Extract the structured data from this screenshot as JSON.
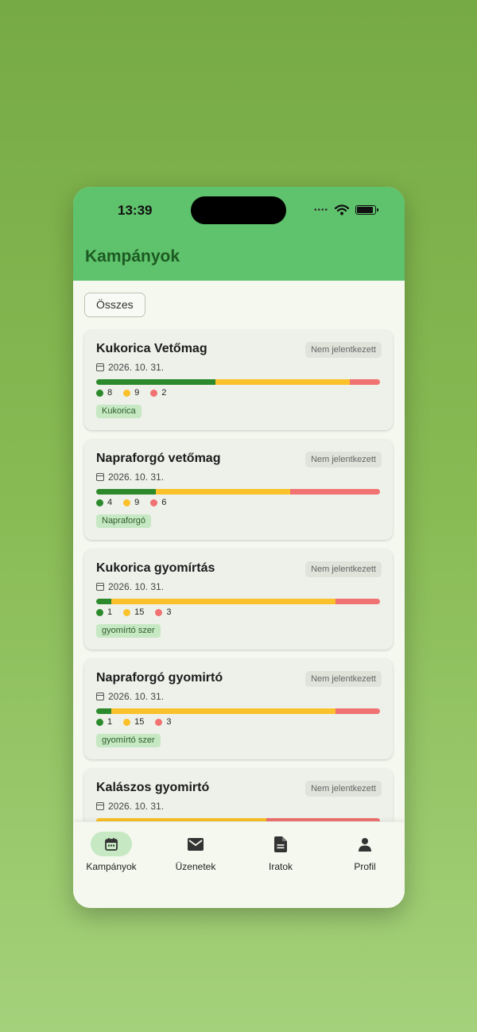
{
  "status": {
    "time": "13:39",
    "dots": "••••"
  },
  "appbar": {
    "title": "Kampányok"
  },
  "filter": {
    "label": "Összes"
  },
  "campaigns": [
    {
      "title": "Kukorica Vetőmag",
      "badge": "Nem jelentkezett",
      "date": "2026. 10. 31.",
      "green": 8,
      "yellow": 9,
      "red": 2,
      "tag": "Kukorica"
    },
    {
      "title": "Napraforgó vetőmag",
      "badge": "Nem jelentkezett",
      "date": "2026. 10. 31.",
      "green": 4,
      "yellow": 9,
      "red": 6,
      "tag": "Napraforgó"
    },
    {
      "title": "Kukorica gyomírtás",
      "badge": "Nem jelentkezett",
      "date": "2026. 10. 31.",
      "green": 1,
      "yellow": 15,
      "red": 3,
      "tag": "gyomírtó szer"
    },
    {
      "title": "Napraforgó gyomirtó",
      "badge": "Nem jelentkezett",
      "date": "2026. 10. 31.",
      "green": 1,
      "yellow": 15,
      "red": 3,
      "tag": "gyomírtó szer"
    },
    {
      "title": "Kalászos gyomirtó",
      "badge": "Nem jelentkezett",
      "date": "2026. 10. 31.",
      "green": 0,
      "yellow": 9,
      "red": 6,
      "tag": ""
    }
  ],
  "colors": {
    "green": "#2c8a2c",
    "yellow": "#fbc12a",
    "red": "#f07272",
    "appbar": "#5fc26c"
  },
  "nav": [
    {
      "label": "Kampányok",
      "icon": "calendar-icon",
      "active": true
    },
    {
      "label": "Üzenetek",
      "icon": "mail-icon",
      "active": false
    },
    {
      "label": "Iratok",
      "icon": "document-icon",
      "active": false
    },
    {
      "label": "Profil",
      "icon": "person-icon",
      "active": false
    }
  ]
}
